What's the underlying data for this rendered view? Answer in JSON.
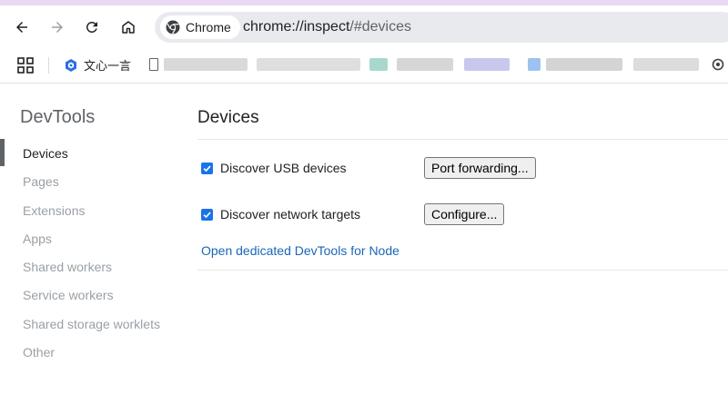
{
  "browser": {
    "chip_label": "Chrome",
    "url_host": "chrome://inspect",
    "url_rest": "/#devices"
  },
  "bookmarks": {
    "item_label": "文心一言"
  },
  "sidebar": {
    "title": "DevTools",
    "items": [
      {
        "label": "Devices",
        "active": true
      },
      {
        "label": "Pages"
      },
      {
        "label": "Extensions"
      },
      {
        "label": "Apps"
      },
      {
        "label": "Shared workers"
      },
      {
        "label": "Service workers"
      },
      {
        "label": "Shared storage worklets"
      },
      {
        "label": "Other"
      }
    ]
  },
  "main": {
    "title": "Devices",
    "usb": {
      "label": "Discover USB devices",
      "checked": true,
      "button": "Port forwarding..."
    },
    "network": {
      "label": "Discover network targets",
      "checked": true,
      "button": "Configure..."
    },
    "node_link": "Open dedicated DevTools for Node"
  },
  "colors": {
    "accent": "#1a73e8",
    "link": "#1a66b8",
    "muted_text": "#9aa0a6",
    "top_strip": "#e9d8f3"
  },
  "icons": [
    "back-arrow-icon",
    "forward-arrow-icon",
    "reload-icon",
    "home-icon",
    "chrome-logo-icon",
    "apps-grid-icon",
    "ernie-bot-icon",
    "document-icon",
    "extension-icon",
    "checkbox-check-icon"
  ]
}
